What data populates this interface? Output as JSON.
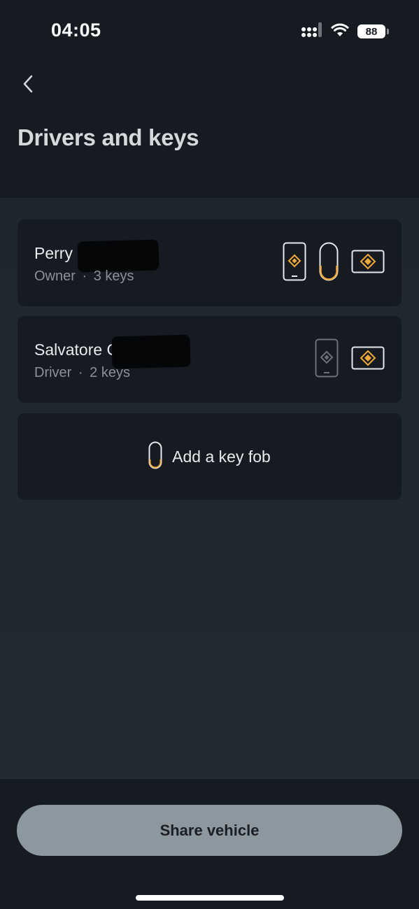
{
  "status_bar": {
    "time": "04:05",
    "battery": "88",
    "icons": [
      "cellular-signal-icon",
      "wifi-icon",
      "battery-icon"
    ]
  },
  "header": {
    "back_icon": "chevron-left-icon",
    "title": "Drivers and keys"
  },
  "people": [
    {
      "name": "Perry G",
      "role": "Owner",
      "separator": "·",
      "keys": "3 keys",
      "key_icons": [
        "phone-key-icon",
        "key-fob-icon",
        "key-card-icon"
      ],
      "name_redacted": true
    },
    {
      "name": "Salvatore G",
      "role": "Driver",
      "separator": "·",
      "keys": "2 keys",
      "key_icons": [
        "phone-key-icon",
        "key-card-icon"
      ],
      "name_redacted": true
    }
  ],
  "add_fob": {
    "icon": "key-fob-icon",
    "label": "Add a key fob"
  },
  "footer": {
    "share_label": "Share vehicle"
  },
  "colors": {
    "accent": "#f2a93b",
    "background": "#161a21",
    "content_bg": "#20272d",
    "card_bg": "#161a21",
    "button_bg": "#8d979f",
    "muted_icon": "#6b7177"
  }
}
